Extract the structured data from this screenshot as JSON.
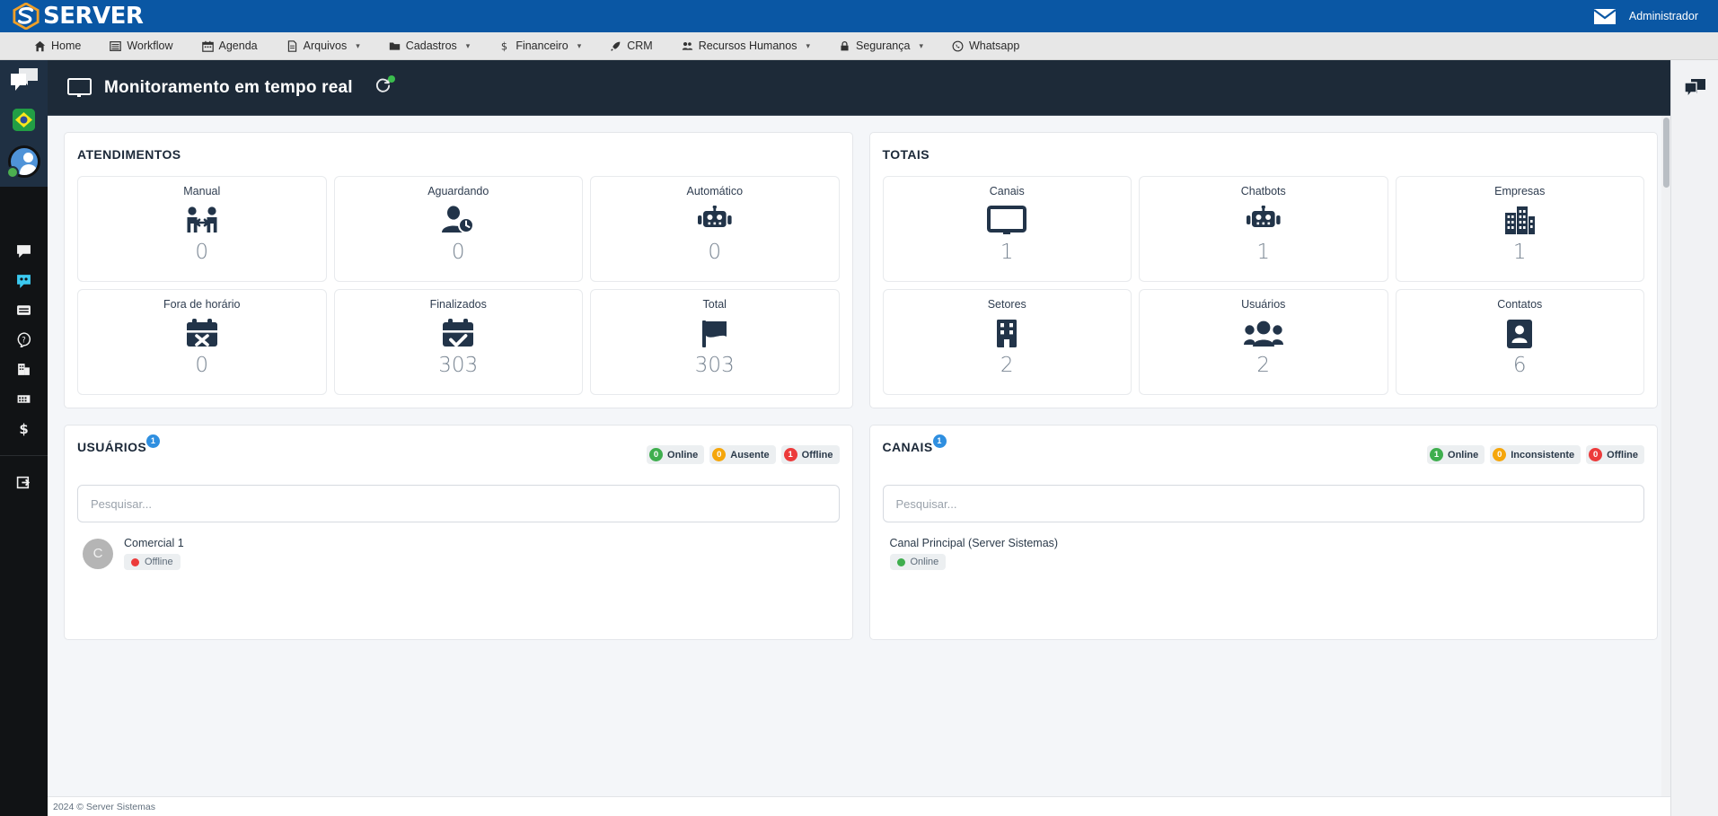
{
  "brand": {
    "name": "SERVER",
    "logo_icon": "server-s-logo"
  },
  "topbar": {
    "mail_icon": "envelope-icon",
    "user_label": "Administrador"
  },
  "menu": [
    {
      "label": "Home",
      "icon": "home-icon",
      "caret": false
    },
    {
      "label": "Workflow",
      "icon": "workflow-icon",
      "caret": false
    },
    {
      "label": "Agenda",
      "icon": "calendar-icon",
      "caret": false
    },
    {
      "label": "Arquivos",
      "icon": "file-icon",
      "caret": true
    },
    {
      "label": "Cadastros",
      "icon": "folder-icon",
      "caret": true
    },
    {
      "label": "Financeiro",
      "icon": "dollar-icon",
      "caret": true
    },
    {
      "label": "CRM",
      "icon": "rocket-icon",
      "caret": false
    },
    {
      "label": "Recursos Humanos",
      "icon": "users-icon",
      "caret": true
    },
    {
      "label": "Segurança",
      "icon": "lock-icon",
      "caret": true
    },
    {
      "label": "Whatsapp",
      "icon": "whatsapp-icon",
      "caret": false
    }
  ],
  "left_rail": {
    "top_icons": [
      {
        "name": "chat-bubbles-icon"
      },
      {
        "name": "brazil-flag-icon"
      },
      {
        "name": "user-avatar-online"
      }
    ],
    "nav_icons": [
      {
        "name": "comment-icon",
        "active": false
      },
      {
        "name": "chatbot-icon",
        "active": true
      },
      {
        "name": "list-card-icon",
        "active": false
      },
      {
        "name": "question-circle-icon",
        "active": false
      },
      {
        "name": "building-icon",
        "active": false
      },
      {
        "name": "grid-icon",
        "active": false
      },
      {
        "name": "dollar-icon",
        "active": false
      },
      {
        "name": "logout-icon",
        "active": false
      }
    ]
  },
  "page_header": {
    "title": "Monitoramento em tempo real",
    "monitor_icon": "monitor-icon",
    "refresh_icon": "refresh-icon",
    "refresh_status": "online"
  },
  "atendimentos": {
    "title": "ATENDIMENTOS",
    "tiles": [
      {
        "label": "Manual",
        "value": "0",
        "icon": "handshake-icon"
      },
      {
        "label": "Aguardando",
        "value": "0",
        "icon": "user-clock-icon"
      },
      {
        "label": "Automático",
        "value": "0",
        "icon": "robot-icon"
      },
      {
        "label": "Fora de horário",
        "value": "0",
        "icon": "calendar-times-icon"
      },
      {
        "label": "Finalizados",
        "value": "303",
        "icon": "calendar-check-icon"
      },
      {
        "label": "Total",
        "value": "303",
        "icon": "flag-icon"
      }
    ]
  },
  "totais": {
    "title": "TOTAIS",
    "tiles": [
      {
        "label": "Canais",
        "value": "1",
        "icon": "monitor-icon"
      },
      {
        "label": "Chatbots",
        "value": "1",
        "icon": "robot-icon"
      },
      {
        "label": "Empresas",
        "value": "1",
        "icon": "city-icon"
      },
      {
        "label": "Setores",
        "value": "2",
        "icon": "building-icon"
      },
      {
        "label": "Usuários",
        "value": "2",
        "icon": "users-group-icon"
      },
      {
        "label": "Contatos",
        "value": "6",
        "icon": "address-card-icon"
      }
    ]
  },
  "usuarios": {
    "title": "USUÁRIOS",
    "count_badge": "1",
    "badges": [
      {
        "count": "0",
        "label": "Online",
        "color": "#3fae4e"
      },
      {
        "count": "0",
        "label": "Ausente",
        "color": "#f5a60b"
      },
      {
        "count": "1",
        "label": "Offline",
        "color": "#ec3b3b"
      }
    ],
    "search_placeholder": "Pesquisar...",
    "search_value": "",
    "items": [
      {
        "initial": "C",
        "name": "Comercial 1",
        "status": "Offline",
        "status_color": "#ec3b3b"
      }
    ]
  },
  "canais": {
    "title": "CANAIS",
    "count_badge": "1",
    "badges": [
      {
        "count": "1",
        "label": "Online",
        "color": "#3fae4e"
      },
      {
        "count": "0",
        "label": "Inconsistente",
        "color": "#f5a60b"
      },
      {
        "count": "0",
        "label": "Offline",
        "color": "#ec3b3b"
      }
    ],
    "search_placeholder": "Pesquisar...",
    "search_value": "",
    "items": [
      {
        "name": "Canal Principal (Server Sistemas)",
        "status": "Online",
        "status_color": "#3fae4e"
      }
    ]
  },
  "right_rail": {
    "icon": "chat-support-icon"
  },
  "footer": {
    "text": "2024 © Server Sistemas"
  }
}
